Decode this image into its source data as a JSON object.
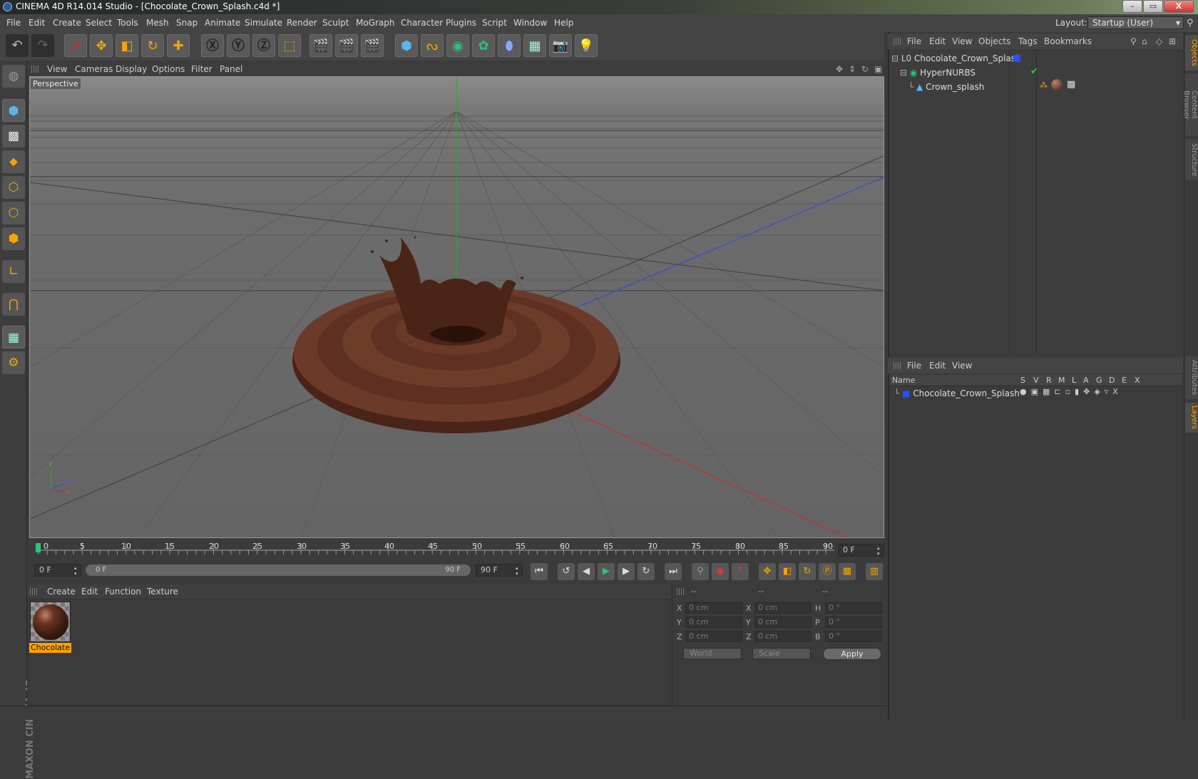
{
  "window": {
    "title": "CINEMA 4D R14.014 Studio - [Chocolate_Crown_Splash.c4d *]",
    "buttons": {
      "minimize": "–",
      "maximize": "▭",
      "close": "X"
    }
  },
  "menubar": {
    "items": [
      "File",
      "Edit",
      "Create",
      "Select",
      "Tools",
      "Mesh",
      "Snap",
      "Animate",
      "Simulate",
      "Render",
      "Sculpt",
      "MoGraph",
      "Character",
      "Plugins",
      "Script",
      "Window",
      "Help"
    ],
    "layout_label": "Layout:",
    "layout_value": "Startup (User)"
  },
  "viewport": {
    "menu": [
      "View",
      "Cameras",
      "Display",
      "Options",
      "Filter",
      "Panel"
    ],
    "label": "Perspective",
    "axis": {
      "y": "y",
      "x": "x",
      "z": "z"
    }
  },
  "timeline": {
    "ticks": [
      "0",
      "5",
      "10",
      "15",
      "20",
      "25",
      "30",
      "35",
      "40",
      "45",
      "50",
      "55",
      "60",
      "65",
      "70",
      "75",
      "80",
      "85",
      "90"
    ],
    "current_frame": "0 F",
    "start_frame": "0 F",
    "range_start": "0 F",
    "range_end": "90 F",
    "end_frame": "90 F"
  },
  "material_manager": {
    "menu": [
      "Create",
      "Edit",
      "Function",
      "Texture"
    ],
    "materials": [
      {
        "name": "Chocolate"
      }
    ]
  },
  "coordinates": {
    "headers": [
      "--",
      "--",
      "--"
    ],
    "rows": [
      {
        "l1": "X",
        "v1": "0 cm",
        "l2": "X",
        "v2": "0 cm",
        "l3": "H",
        "v3": "0 °"
      },
      {
        "l1": "Y",
        "v1": "0 cm",
        "l2": "Y",
        "v2": "0 cm",
        "l3": "P",
        "v3": "0 °"
      },
      {
        "l1": "Z",
        "v1": "0 cm",
        "l2": "Z",
        "v2": "0 cm",
        "l3": "B",
        "v3": "0 °"
      }
    ],
    "space": "World",
    "mode": "Scale",
    "apply_label": "Apply"
  },
  "object_manager": {
    "menu": [
      "File",
      "Edit",
      "View",
      "Objects",
      "Tags",
      "Bookmarks"
    ],
    "objects": [
      {
        "name": "Chocolate_Crown_Splash"
      },
      {
        "name": "HyperNURBS"
      },
      {
        "name": "Crown_splash"
      }
    ]
  },
  "layer_manager": {
    "menu": [
      "File",
      "Edit",
      "View"
    ],
    "columns": [
      "Name",
      "S",
      "V",
      "R",
      "M",
      "L",
      "A",
      "G",
      "D",
      "E",
      "X"
    ],
    "layers": [
      {
        "name": "Chocolate_Crown_Splash",
        "color": "#2a4dff"
      }
    ]
  },
  "side_tabs": [
    "Objects",
    "Content Browser",
    "Structure",
    "Attributes",
    "Layers"
  ],
  "colors": {
    "accent": "#ffa200",
    "x_axis": "#c0322d",
    "y_axis": "#33a32c",
    "z_axis": "#3a4cc8"
  }
}
